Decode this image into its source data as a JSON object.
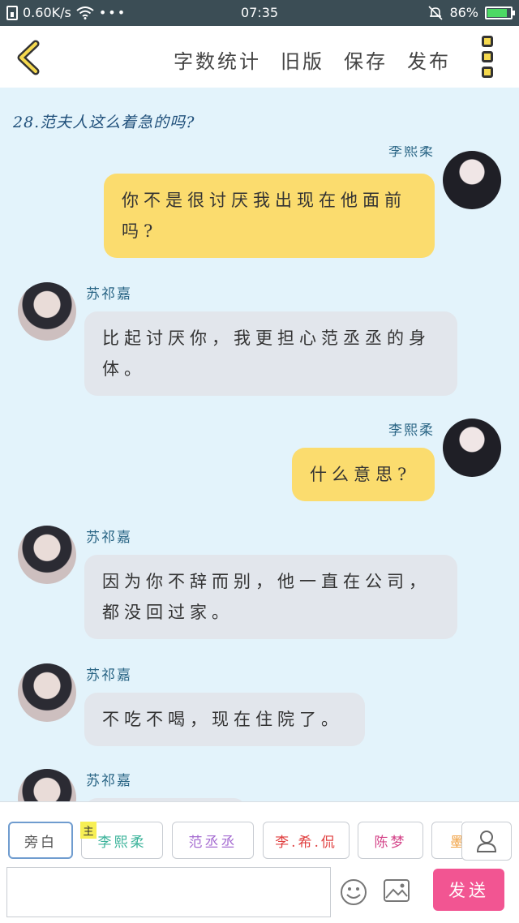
{
  "status_bar": {
    "speed": "0.60K/s",
    "time": "07:35",
    "battery": "86%",
    "battery_level": 0.86,
    "icons": [
      "sim-icon",
      "wifi-icon",
      "more-icon",
      "mute-icon",
      "battery-icon"
    ]
  },
  "topbar": {
    "actions": [
      "字数统计",
      "旧版",
      "保存",
      "发布"
    ],
    "icons": [
      "back-icon",
      "menu-icon"
    ],
    "accent": "#f5d94e"
  },
  "chapter_title": "28.范夫人这么着急的吗?",
  "messages": [
    {
      "side": "right",
      "name": "李熙柔",
      "text": "你不是很讨厌我出现在他面前吗?"
    },
    {
      "side": "left",
      "name": "苏祁嘉",
      "text": "比起讨厌你，我更担心范丞丞的身体。"
    },
    {
      "side": "right",
      "name": "李熙柔",
      "text": "什么意思?"
    },
    {
      "side": "left",
      "name": "苏祁嘉",
      "text": "因为你不辞而别，他一直在公司，都没回过家。"
    },
    {
      "side": "left",
      "name": "苏祁嘉",
      "text": "不吃不喝，现在住院了。"
    },
    {
      "side": "left",
      "name": "苏祁嘉",
      "text": ""
    }
  ],
  "colors": {
    "bubble_right": "#fbdc6e",
    "bubble_left": "#e2e6ec",
    "background": "#e3f3fb",
    "send": "#f25592"
  },
  "roles": [
    {
      "label": "旁白",
      "color": "#555555",
      "active": true
    },
    {
      "label": "李熙柔",
      "color": "#3bb39a",
      "tag": "主"
    },
    {
      "label": "范丞丞",
      "color": "#a56cd1"
    },
    {
      "label": "李.希.侃",
      "color": "#e04040"
    },
    {
      "label": "陈梦",
      "color": "#d4468a"
    },
    {
      "label": "墨",
      "color": "#f0a040"
    }
  ],
  "input": {
    "value": "",
    "placeholder": ""
  },
  "send_label": "发送"
}
